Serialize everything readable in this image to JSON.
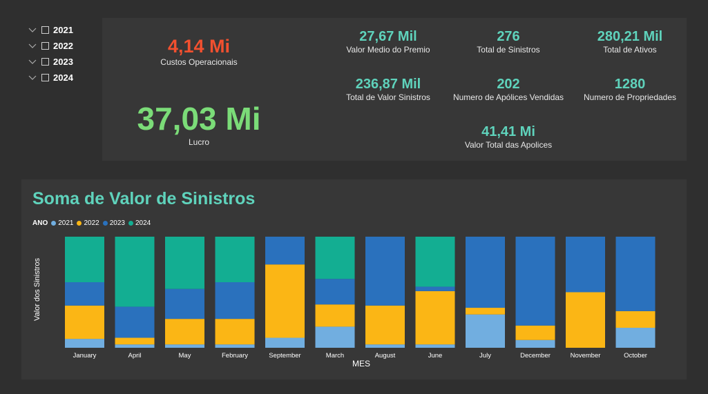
{
  "slicer": {
    "items": [
      {
        "label": "2021"
      },
      {
        "label": "2022"
      },
      {
        "label": "2023"
      },
      {
        "label": "2024"
      }
    ]
  },
  "kpis": {
    "custos": {
      "value": "4,14 Mi",
      "label": "Custos Operacionais",
      "color": "#f2502f"
    },
    "lucro": {
      "value": "37,03 Mi",
      "label": "Lucro",
      "color": "#7bdc78"
    },
    "premio": {
      "value": "27,67 Mil",
      "label": "Valor Medio do Premio"
    },
    "total_sinistros": {
      "value": "276",
      "label": "Total de Sinistros"
    },
    "total_ativos": {
      "value": "280,21 Mil",
      "label": "Total de Ativos"
    },
    "valor_sinistros": {
      "value": "236,87 Mil",
      "label": "Total de Valor Sinistros"
    },
    "apolices_vendidas": {
      "value": "202",
      "label": "Numero de Apólices Vendidas"
    },
    "propriedades": {
      "value": "1280",
      "label": "Numero de Propriedades"
    },
    "valor_apolices": {
      "value": "41,41 Mi",
      "label": "Valor Total das Apolices"
    }
  },
  "colors": {
    "accent": "#5fd3bc",
    "panel": "#373737",
    "background": "#2f2f2f"
  },
  "chart_data": {
    "type": "bar",
    "stacking": "percent",
    "title": "Soma de Valor de Sinistros",
    "xlabel": "MES",
    "ylabel": "Valor dos Sinistros",
    "legend_title": "ANO",
    "legend_position": "top-left",
    "grid": false,
    "ylim": [
      0,
      100
    ],
    "categories": [
      "January",
      "April",
      "May",
      "February",
      "September",
      "March",
      "August",
      "June",
      "July",
      "December",
      "November",
      "October"
    ],
    "series": [
      {
        "name": "2021",
        "color": "#71aee0",
        "values": [
          8,
          3,
          3,
          3,
          9,
          19,
          3,
          3,
          30,
          7,
          0,
          18
        ]
      },
      {
        "name": "2022",
        "color": "#fbb615",
        "values": [
          30,
          6,
          23,
          23,
          66,
          20,
          35,
          48,
          6,
          13,
          50,
          15
        ]
      },
      {
        "name": "2023",
        "color": "#2a71bd",
        "values": [
          21,
          28,
          27,
          33,
          25,
          23,
          62,
          4,
          64,
          80,
          50,
          67
        ]
      },
      {
        "name": "2024",
        "color": "#13ae92",
        "values": [
          41,
          63,
          47,
          41,
          0,
          38,
          0,
          45,
          0,
          0,
          0,
          0
        ]
      }
    ]
  }
}
